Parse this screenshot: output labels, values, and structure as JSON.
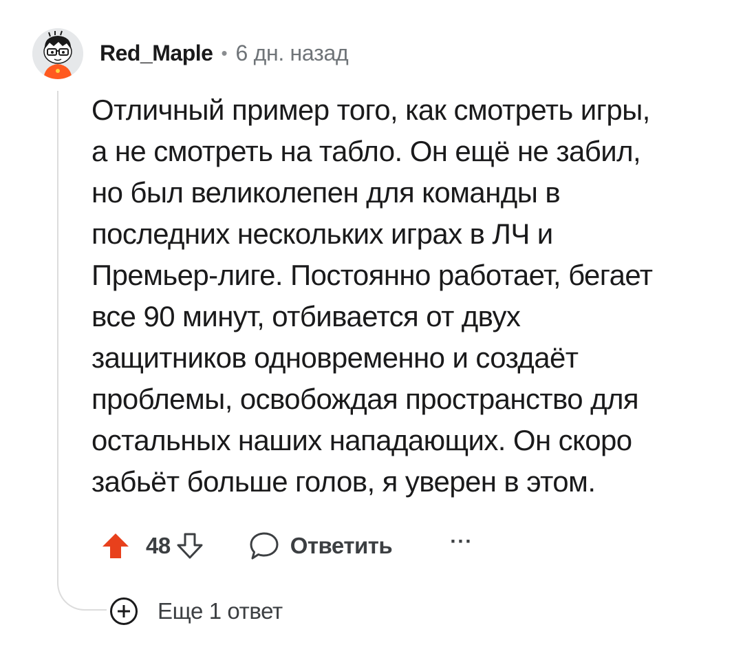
{
  "comment": {
    "author": "Red_Maple",
    "separator": "•",
    "timestamp": "6 дн. назад",
    "body_lines": [
      "Отличный пример того, как смотреть игры,",
      "а не смотреть на табло. Он ещё не забил,",
      "но был великолепен для команды в",
      "последних нескольких играх в ЛЧ и",
      "Премьер-лиге. Постоянно работает, бегает",
      "все 90 минут, отбивается от двух",
      "защитников одновременно и создаёт",
      "проблемы, освобождая пространство для",
      "остальных наших нападающих. Он скоро",
      "забьёт больше голов, я уверен в этом."
    ],
    "actions": {
      "upvote_icon": "arrow-up-filled-icon",
      "score": "48",
      "downvote_icon": "arrow-down-outline-icon",
      "reply_icon": "speech-bubble-icon",
      "reply_label": "Ответить",
      "more_label": "···"
    },
    "more_replies": {
      "icon": "plus-circle-icon",
      "label": "Еще 1 ответ"
    }
  },
  "colors": {
    "upvote_active": "#e8401c",
    "text_primary": "#1a1a1b",
    "text_secondary": "#6f7478",
    "thread_line": "#dcdcdc"
  }
}
